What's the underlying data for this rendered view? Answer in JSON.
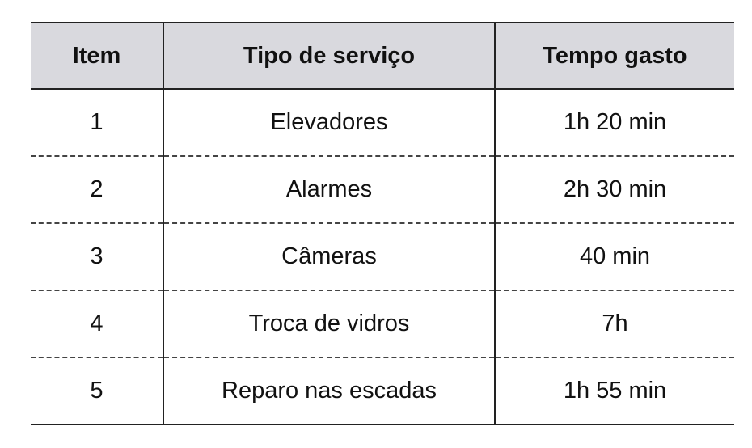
{
  "table": {
    "headers": [
      "Item",
      "Tipo de serviço",
      "Tempo gasto"
    ],
    "rows": [
      [
        "1",
        "Elevadores",
        "1h 20 min"
      ],
      [
        "2",
        "Alarmes",
        "2h 30 min"
      ],
      [
        "3",
        "Câmeras",
        "40 min"
      ],
      [
        "4",
        "Troca de vidros",
        "7h"
      ],
      [
        "5",
        "Reparo nas escadas",
        "1h 55 min"
      ]
    ]
  }
}
